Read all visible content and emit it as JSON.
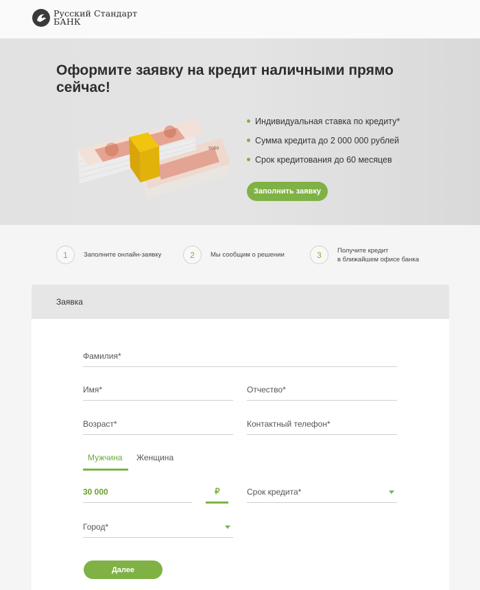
{
  "header": {
    "logo_line1": "Русский Стандарт",
    "logo_line2": "БАНК"
  },
  "hero": {
    "title": "Оформите заявку на кредит наличными прямо сейчас!",
    "features": [
      "Индивидуальная ставка по кредиту*",
      "Сумма кредита до 2 000 000 рублей",
      "Срок кредитования до 60 месяцев"
    ],
    "cta_label": "Заполнить заявку",
    "banknote_value": "5000"
  },
  "steps": [
    {
      "num": "1",
      "text_line1": "Заполните онлайн-заявку",
      "text_line2": ""
    },
    {
      "num": "2",
      "text_line1": "Мы сообщим о решении",
      "text_line2": ""
    },
    {
      "num": "3",
      "text_line1": "Получите кредит",
      "text_line2": "в ближайшем офисе банка"
    }
  ],
  "form": {
    "title": "Заявка",
    "surname_label": "Фамилия*",
    "name_label": "Имя*",
    "patronymic_label": "Отчество*",
    "age_label": "Возраст*",
    "phone_label": "Контактный телефон*",
    "gender_options": [
      "Мужчина",
      "Женщина"
    ],
    "gender_selected": "Мужчина",
    "amount_value": "30 000",
    "currency_symbol": "₽",
    "term_label": "Срок кредита*",
    "city_label": "Город*",
    "next_label": "Далее"
  },
  "colors": {
    "accent": "#7db244",
    "hero_bg": "#e2e2e2",
    "page_bg": "#f4f5f4"
  }
}
